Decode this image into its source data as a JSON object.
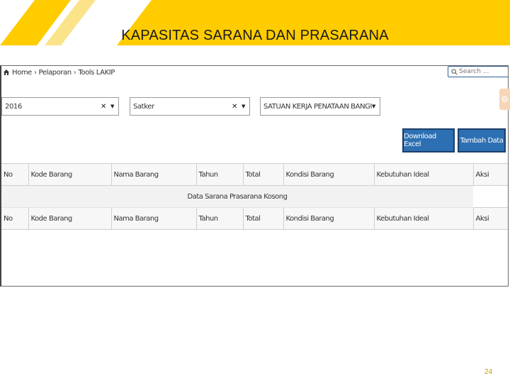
{
  "slide": {
    "title": "KAPASITAS SARANA DAN PRASARANA",
    "page_number": "24",
    "accent_color": "#FFCC00",
    "accent_light": "#FBE38A"
  },
  "app": {
    "breadcrumb": [
      "Home",
      "Pelaporan",
      "Tools LAKIP"
    ],
    "search": {
      "placeholder": "Search ...",
      "value": ""
    },
    "filters": {
      "year": "2016",
      "satker": "Satker",
      "unit": "SATUAN KERJA PENATAAN BANGUNAN D..."
    },
    "buttons": {
      "download_excel": "Download Excel",
      "tambah_data": "Tambah Data"
    },
    "table": {
      "columns": [
        "No",
        "Kode Barang",
        "Nama Barang",
        "Tahun",
        "Total",
        "Kondisi Barang",
        "Kebutuhan Ideal",
        "Aksi"
      ],
      "empty_message": "Data Sarana Prasarana Kosong"
    },
    "icons": {
      "home": "home-icon",
      "search": "search-icon",
      "settings": "gear-icon",
      "clear": "clear-icon",
      "dropdown": "caret-down-icon"
    }
  }
}
